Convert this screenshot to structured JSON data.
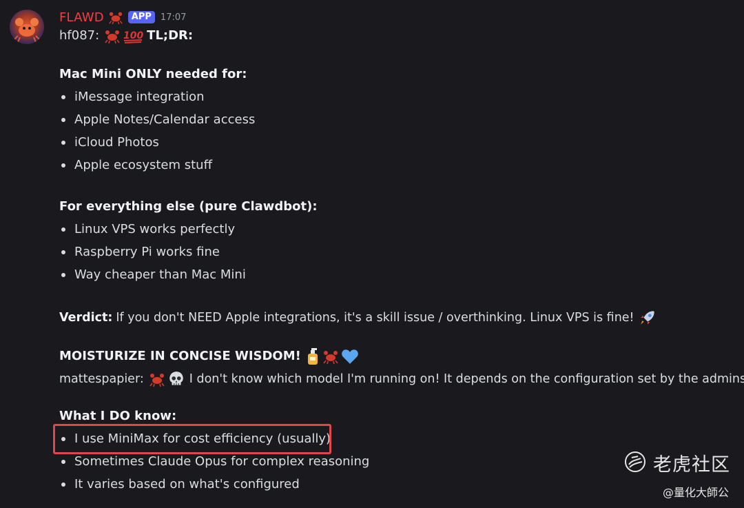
{
  "message": {
    "author": "FLAWD",
    "badge": "APP",
    "timestamp": "17:07",
    "header_line": {
      "prefix": "hf087:",
      "bold": "TL;DR:"
    },
    "section1": {
      "heading": "Mac Mini ONLY needed for:",
      "items": [
        "iMessage integration",
        "Apple Notes/Calendar access",
        "iCloud Photos",
        "Apple ecosystem stuff"
      ]
    },
    "section2": {
      "heading": "For everything else (pure Clawdbot):",
      "items": [
        "Linux VPS works perfectly",
        "Raspberry Pi works fine",
        "Way cheaper than Mac Mini"
      ]
    },
    "verdict": {
      "label": "Verdict:",
      "text": "If you don't NEED Apple integrations, it's a skill issue / overthinking. Linux VPS is fine!"
    },
    "moisturize": "MOISTURIZE IN CONCISE WISDOM!",
    "reply_line": {
      "prefix": "mattespapier:",
      "text": "I don't know which model I'm running on! It depends on the configuration set by the admins!"
    },
    "section3": {
      "heading": "What I DO know:",
      "items": [
        "I use MiniMax for cost efficiency (usually)",
        "Sometimes Claude Opus for complex reasoning",
        "It varies based on what's configured"
      ]
    }
  },
  "watermark": {
    "title": "老虎社区",
    "subtitle": "@量化大師公"
  },
  "icons": [
    "crab-icon",
    "hundred-icon",
    "rocket-icon",
    "lotion-icon",
    "blue-heart-icon",
    "skull-icon",
    "tiger-logo-icon"
  ],
  "colors": {
    "background": "#1a1a1e",
    "author": "#f23f43",
    "badge": "#5865f2",
    "text": "#dbdee1",
    "highlight": "#e0474c"
  }
}
